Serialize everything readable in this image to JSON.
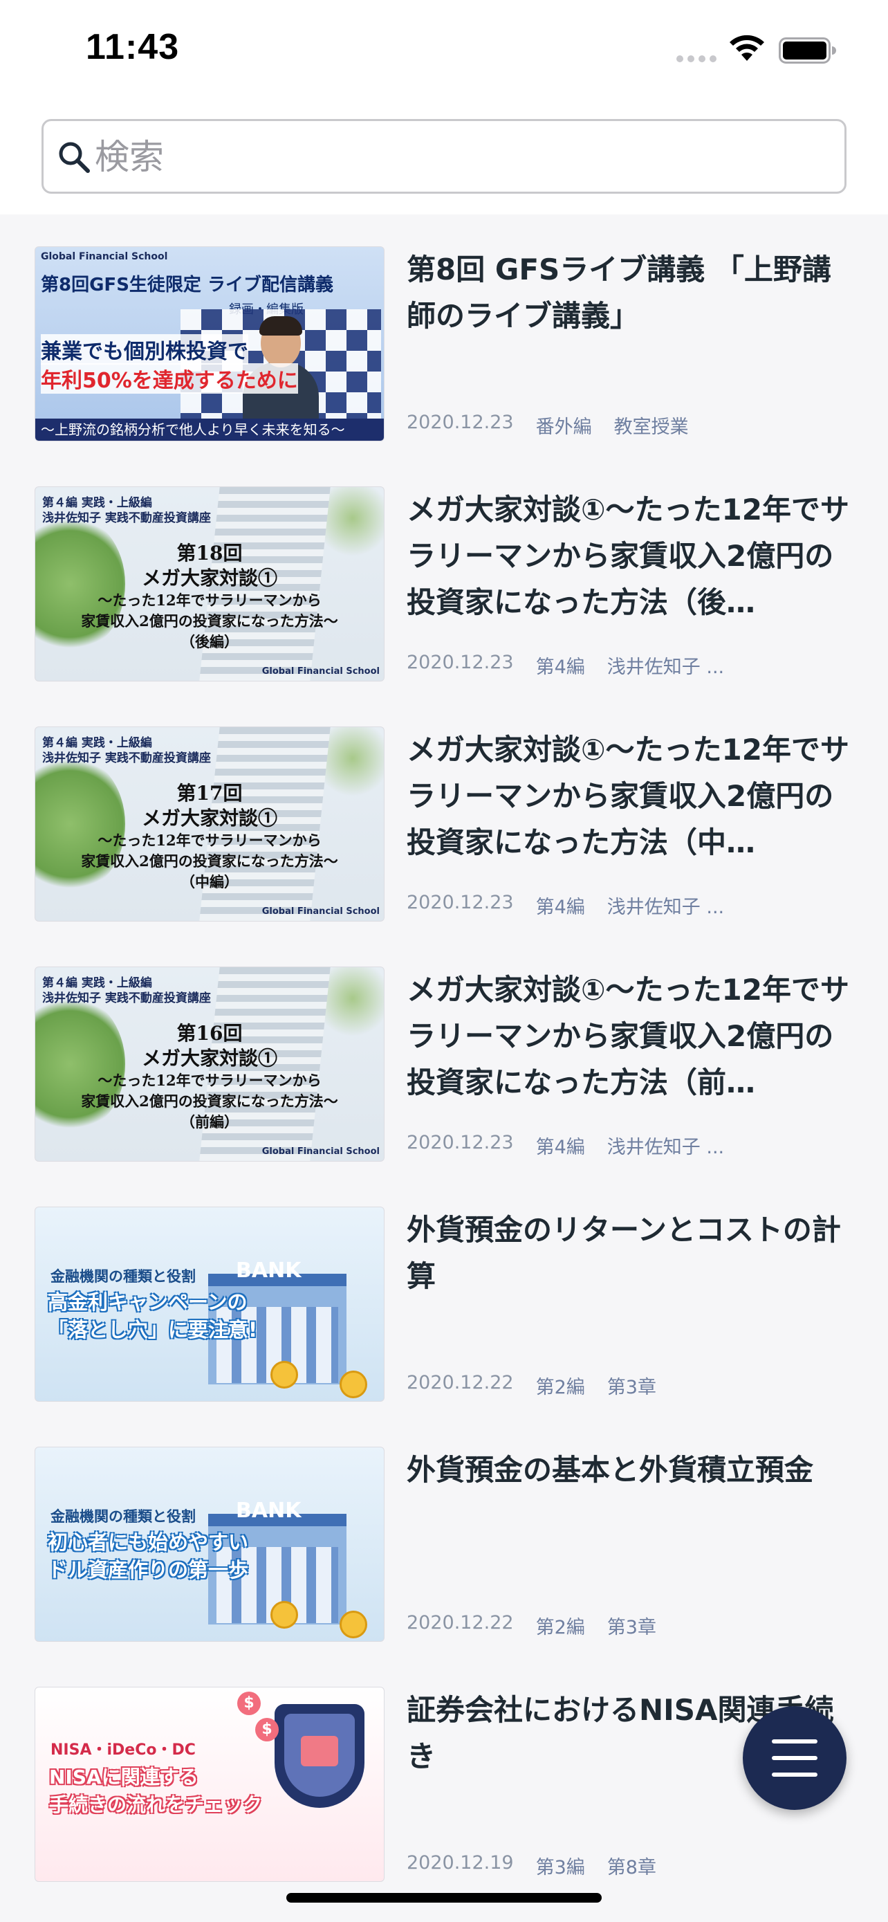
{
  "status_bar": {
    "time": "11:43"
  },
  "search": {
    "placeholder": "検索",
    "value": ""
  },
  "thumbs": {
    "live": {
      "header": "Global Financial School",
      "title": "第8回GFS生徒限定 ライブ配信講義",
      "subtitle": "録画・編集版",
      "line1": "兼業でも個別株投資で",
      "line2": "年利50%を達成するために",
      "footer": "～上野流の銘柄分析で他人より早く未来を知る～"
    },
    "bldg_header1": "第４編 実践・上級編",
    "bldg_header2": "浅井佐知子 実践不動産投資講座",
    "bldg_title": "メガ大家対談①",
    "bldg_line1": "～たった12年でサラリーマンから",
    "bldg_line2": "家賃収入2億円の投資家になった方法～",
    "bldg_logo": "Global Financial School",
    "bank_caption": "金融機関の種類と役割",
    "bank_label": "BANK",
    "nisa_caption": "NISA・iDeCo・DC",
    "nisa_line1": "NISAに関連する",
    "nisa_line2": "手続きの流れをチェック"
  },
  "items": [
    {
      "title": "第8回 GFSライブ講義 「上野講師のライブ講義」",
      "date": "2020.12.23",
      "tags": [
        "番外編",
        "教室授業"
      ]
    },
    {
      "title": "メガ大家対談①～たった12年でサラリーマンから家賃収入2億円の投資家になった方法（後…",
      "date": "2020.12.23",
      "tags": [
        "第4編",
        "浅井佐知子 ..."
      ],
      "thumb_no": "第18回",
      "thumb_part": "（後編）"
    },
    {
      "title": "メガ大家対談①～たった12年でサラリーマンから家賃収入2億円の投資家になった方法（中…",
      "date": "2020.12.23",
      "tags": [
        "第4編",
        "浅井佐知子 ..."
      ],
      "thumb_no": "第17回",
      "thumb_part": "（中編）"
    },
    {
      "title": "メガ大家対談①～たった12年でサラリーマンから家賃収入2億円の投資家になった方法（前…",
      "date": "2020.12.23",
      "tags": [
        "第4編",
        "浅井佐知子 ..."
      ],
      "thumb_no": "第16回",
      "thumb_part": "（前編）"
    },
    {
      "title": "外貨預金のリターンとコストの計算",
      "date": "2020.12.22",
      "tags": [
        "第2編",
        "第3章"
      ],
      "thumb_line1": "高金利キャンペーンの",
      "thumb_line2": "「落とし穴」に要注意!"
    },
    {
      "title": "外貨預金の基本と外貨積立預金",
      "date": "2020.12.22",
      "tags": [
        "第2編",
        "第3章"
      ],
      "thumb_line1": "初心者にも始めやすい",
      "thumb_line2": "ドル資産作りの第一歩"
    },
    {
      "title": "証券会社におけるNISA関連手続き",
      "date": "2020.12.19",
      "tags": [
        "第3編",
        "第8章"
      ]
    }
  ],
  "icons": {
    "search": "search-icon",
    "wifi": "wifi-icon",
    "battery": "battery-icon",
    "menu": "hamburger-menu-icon"
  },
  "colors": {
    "fab": "#1c2a52",
    "title": "#1f2a33",
    "meta": "#8a94a4"
  }
}
